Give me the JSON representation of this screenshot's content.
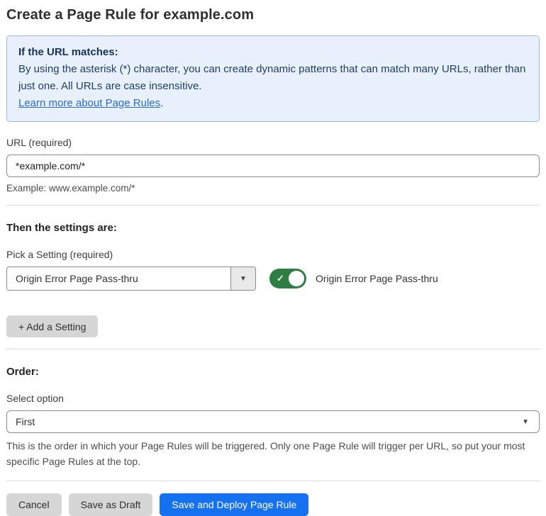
{
  "title": "Create a Page Rule for example.com",
  "info_box": {
    "heading": "If the URL matches:",
    "body": "By using the asterisk (*) character, you can create dynamic patterns that can match many URLs, rather than just one. All URLs are case insensitive.",
    "link_label": "Learn more about Page Rules",
    "link_suffix": "."
  },
  "url_field": {
    "label": "URL (required)",
    "value": "*example.com/*",
    "example": "Example: www.example.com/*"
  },
  "settings_section": {
    "heading": "Then the settings are:",
    "pick_label": "Pick a Setting (required)",
    "selected_setting": "Origin Error Page Pass-thru",
    "toggle_state": "on",
    "toggle_label": "Origin Error Page Pass-thru",
    "add_setting_label": "+ Add a Setting"
  },
  "order_section": {
    "heading": "Order:",
    "select_label": "Select option",
    "selected_option": "First",
    "help_text": "This is the order in which your Page Rules will be triggered. Only one Page Rule will trigger per URL, so put your most specific Page Rules at the top."
  },
  "actions": {
    "cancel_label": "Cancel",
    "save_draft_label": "Save as Draft",
    "save_deploy_label": "Save and Deploy Page Rule"
  },
  "icons": {
    "caret_down": "▼",
    "check": "✓"
  },
  "colors": {
    "info_bg": "#e8f1fb",
    "info_border": "#96bce4",
    "info_text": "#1e3e6e",
    "link_blue": "#2c6bd9",
    "toggle_green": "#2e7d41",
    "primary_blue": "#1671f0",
    "button_gray": "#d6d6d6"
  }
}
